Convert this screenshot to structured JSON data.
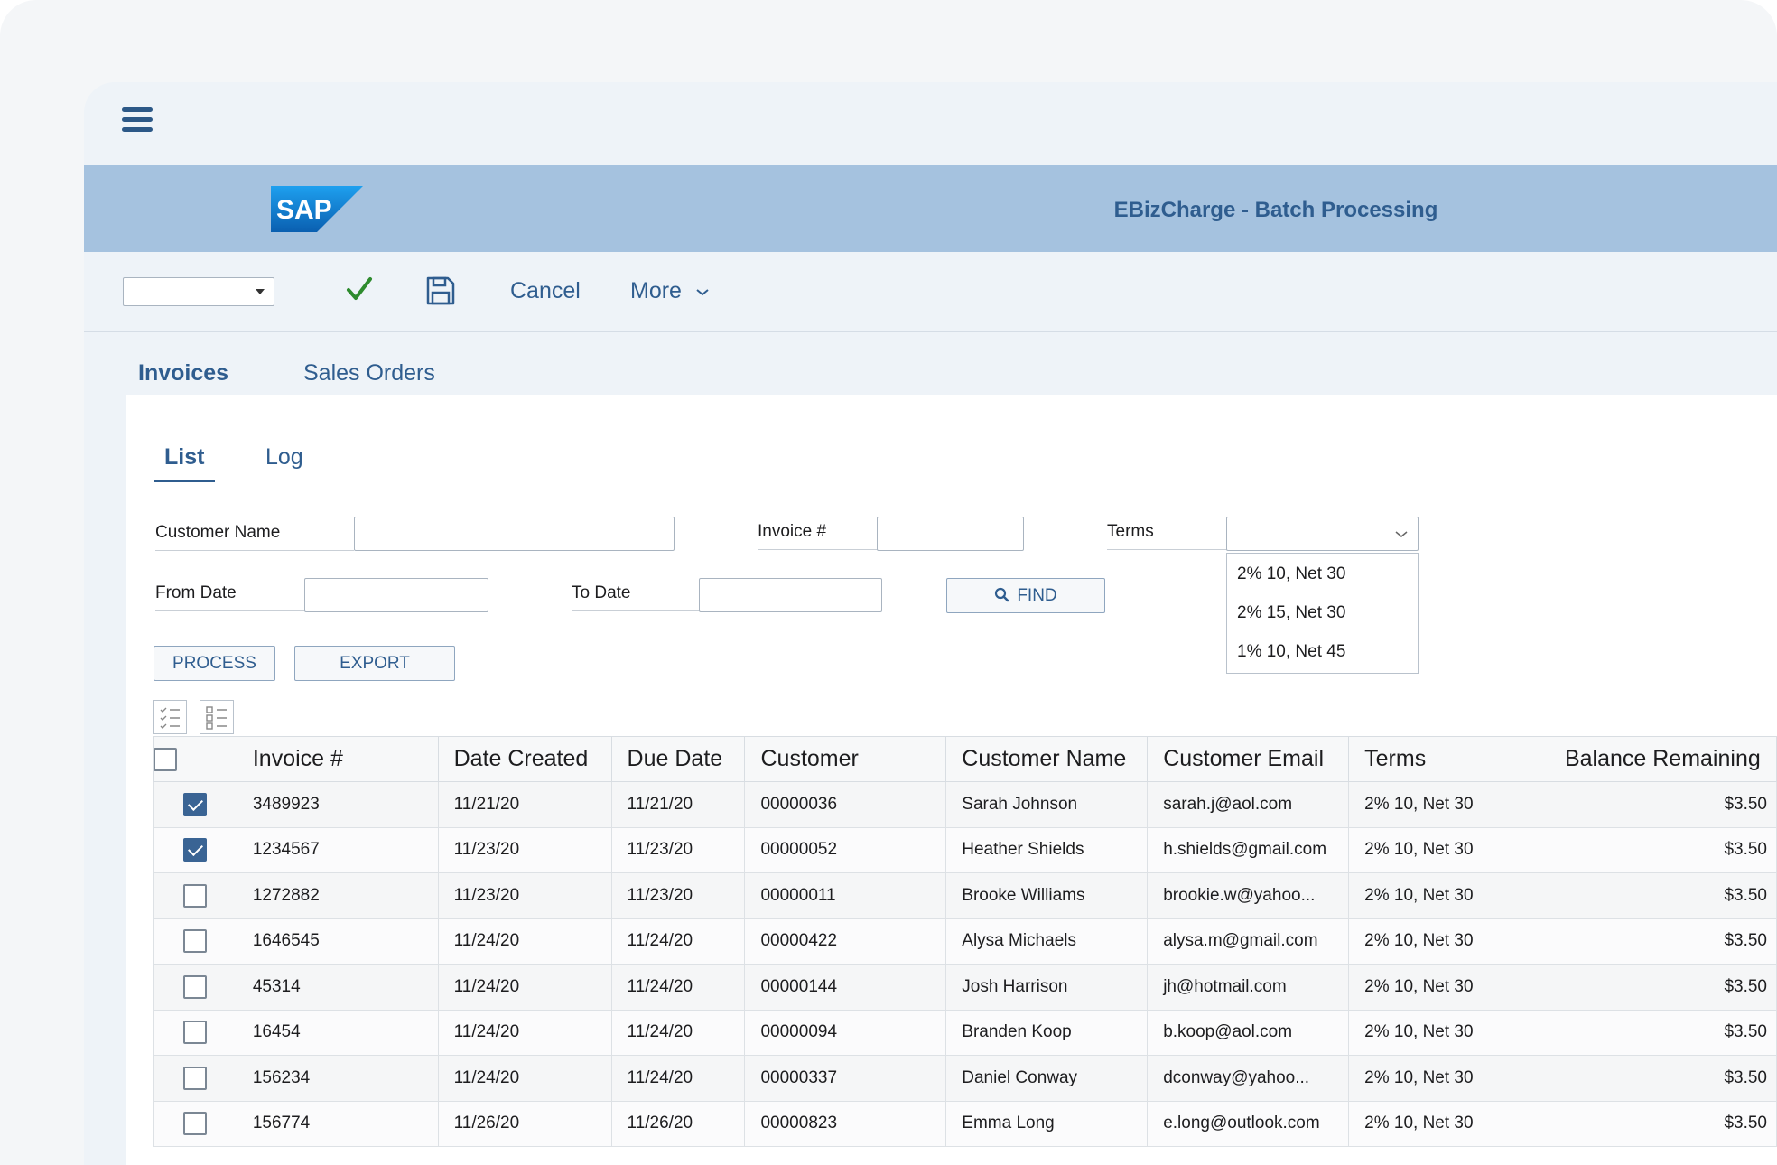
{
  "app": {
    "title": "EBizCharge - Batch Processing",
    "logo_text": "SAP"
  },
  "toolbar": {
    "select_value": "",
    "cancel_label": "Cancel",
    "more_label": "More"
  },
  "tabs": [
    {
      "label": "Invoices",
      "active": true
    },
    {
      "label": "Sales Orders",
      "active": false
    }
  ],
  "subtabs": [
    {
      "label": "List",
      "active": true
    },
    {
      "label": "Log",
      "active": false
    }
  ],
  "filters": {
    "customer_name_label": "Customer Name",
    "customer_name_value": "",
    "invoice_label": "Invoice #",
    "invoice_value": "",
    "terms_label": "Terms",
    "terms_value": "",
    "terms_options": [
      "2% 10, Net 30",
      "2% 15, Net 30",
      "1% 10, Net 45"
    ],
    "from_date_label": "From Date",
    "from_date_value": "",
    "to_date_label": "To Date",
    "to_date_value": "",
    "find_label": "FIND"
  },
  "actions": {
    "process_label": "PROCESS",
    "export_label": "EXPORT"
  },
  "table": {
    "columns": [
      "Invoice #",
      "Date Created",
      "Due Date",
      "Customer",
      "Customer Name",
      "Customer Email",
      "Terms",
      "Balance Remaining"
    ],
    "rows": [
      {
        "checked": true,
        "invoice": "3489923",
        "created": "11/21/20",
        "due": "11/21/20",
        "customer": "00000036",
        "name": "Sarah Johnson",
        "email": "sarah.j@aol.com",
        "terms": "2% 10, Net 30",
        "balance": "$3.50"
      },
      {
        "checked": true,
        "invoice": "1234567",
        "created": "11/23/20",
        "due": "11/23/20",
        "customer": "00000052",
        "name": "Heather Shields",
        "email": "h.shields@gmail.com",
        "terms": "2% 10, Net 30",
        "balance": "$3.50"
      },
      {
        "checked": false,
        "invoice": "1272882",
        "created": "11/23/20",
        "due": "11/23/20",
        "customer": "00000011",
        "name": "Brooke Williams",
        "email": "brookie.w@yahoo...",
        "terms": "2% 10, Net 30",
        "balance": "$3.50"
      },
      {
        "checked": false,
        "invoice": "1646545",
        "created": "11/24/20",
        "due": "11/24/20",
        "customer": "00000422",
        "name": "Alysa Michaels",
        "email": "alysa.m@gmail.com",
        "terms": "2% 10, Net 30",
        "balance": "$3.50"
      },
      {
        "checked": false,
        "invoice": "45314",
        "created": "11/24/20",
        "due": "11/24/20",
        "customer": "00000144",
        "name": "Josh Harrison",
        "email": "jh@hotmail.com",
        "terms": "2% 10, Net 30",
        "balance": "$3.50"
      },
      {
        "checked": false,
        "invoice": "16454",
        "created": "11/24/20",
        "due": "11/24/20",
        "customer": "00000094",
        "name": "Branden Koop",
        "email": "b.koop@aol.com",
        "terms": "2% 10, Net 30",
        "balance": "$3.50"
      },
      {
        "checked": false,
        "invoice": "156234",
        "created": "11/24/20",
        "due": "11/24/20",
        "customer": "00000337",
        "name": "Daniel Conway",
        "email": "dconway@yahoo...",
        "terms": "2% 10, Net 30",
        "balance": "$3.50"
      },
      {
        "checked": false,
        "invoice": "156774",
        "created": "11/26/20",
        "due": "11/26/20",
        "customer": "00000823",
        "name": "Emma Long",
        "email": "e.long@outlook.com",
        "terms": "2% 10, Net 30",
        "balance": "$3.50"
      }
    ]
  },
  "colors": {
    "accent": "#2f5d8f",
    "banner": "#a5c2df",
    "check_green": "#2e8b2e",
    "logo_blue": "#1a73c8"
  }
}
